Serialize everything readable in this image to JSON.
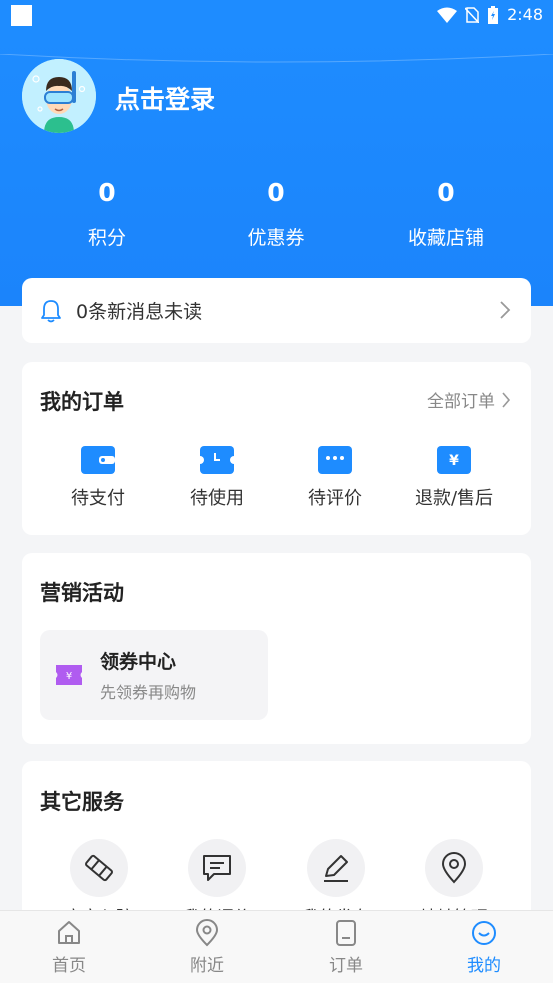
{
  "status_bar": {
    "time": "2:48"
  },
  "profile": {
    "login_label": "点击登录"
  },
  "stats": [
    {
      "value": "0",
      "label": "积分"
    },
    {
      "value": "0",
      "label": "优惠券"
    },
    {
      "value": "0",
      "label": "收藏店铺"
    }
  ],
  "messages": {
    "text": "0条新消息未读"
  },
  "orders": {
    "title": "我的订单",
    "all_label": "全部订单",
    "items": [
      {
        "label": "待支付",
        "icon": "wallet-icon"
      },
      {
        "label": "待使用",
        "icon": "ticket-icon"
      },
      {
        "label": "待评价",
        "icon": "comment-icon"
      },
      {
        "label": "退款/售后",
        "icon": "yen-icon"
      }
    ]
  },
  "marketing": {
    "title": "营销活动",
    "coupon": {
      "title": "领券中心",
      "subtitle": "先领券再购物"
    }
  },
  "services": {
    "title": "其它服务",
    "items": [
      {
        "label": "商家入驻",
        "icon": "handshake-icon"
      },
      {
        "label": "我的评价",
        "icon": "comment-icon"
      },
      {
        "label": "我的发布",
        "icon": "edit-icon"
      },
      {
        "label": "地址管理",
        "icon": "location-icon"
      }
    ]
  },
  "nav": [
    {
      "label": "首页",
      "icon": "home-icon"
    },
    {
      "label": "附近",
      "icon": "location-icon"
    },
    {
      "label": "订单",
      "icon": "order-icon"
    },
    {
      "label": "我的",
      "icon": "smile-icon",
      "active": true
    }
  ],
  "colors": {
    "primary": "#1e8cff",
    "coupon_accent": "#b05cf0"
  }
}
